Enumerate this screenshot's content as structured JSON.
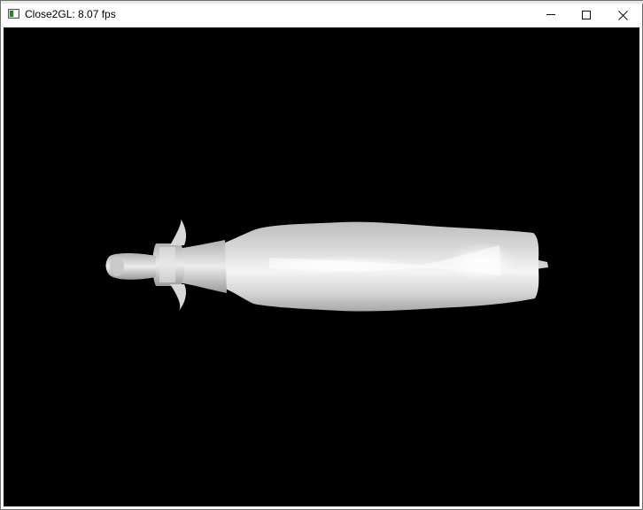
{
  "window": {
    "title": "Close2GL: 8.07 fps",
    "icon": "app-window-icon",
    "controls": {
      "minimize_icon": "minimize-icon",
      "maximize_icon": "maximize-icon",
      "close_icon": "close-icon"
    }
  },
  "viewport": {
    "background_color": "#000000",
    "model_color": "#f2f2f2"
  }
}
